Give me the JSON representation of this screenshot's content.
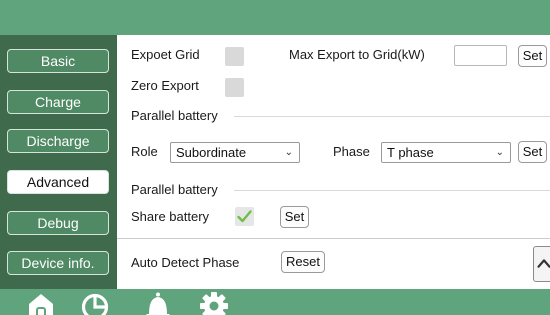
{
  "sidebar": {
    "items": [
      {
        "label": "Basic",
        "active": false
      },
      {
        "label": "Charge",
        "active": false
      },
      {
        "label": "Discharge",
        "active": false
      },
      {
        "label": "Advanced",
        "active": true
      },
      {
        "label": "Debug",
        "active": false
      },
      {
        "label": "Device info.",
        "active": false
      }
    ]
  },
  "advanced": {
    "expoet_grid_label": "Expoet Grid",
    "max_export_label": "Max Export to Grid(kW)",
    "max_export_value": "",
    "set_label": "Set",
    "zero_export_label": "Zero Export",
    "parallel_section_1": "Parallel battery",
    "role_label": "Role",
    "role_value": "Subordinate",
    "phase_label": "Phase",
    "phase_value": "T phase",
    "parallel_section_2": "Parallel battery",
    "share_battery_label": "Share battery",
    "share_battery_checked": true,
    "auto_detect_label": "Auto Detect Phase",
    "reset_label": "Reset"
  },
  "bottom_nav": {
    "tabs": [
      {
        "icon": "home-icon"
      },
      {
        "icon": "chart-icon"
      },
      {
        "icon": "bell-icon"
      },
      {
        "icon": "gear-icon",
        "active": true
      }
    ]
  },
  "colors": {
    "header_green": "#5fa47c",
    "sidebar_green": "#3f6a4c",
    "button_green": "#4f8a64",
    "check_green": "#6cc04a"
  }
}
